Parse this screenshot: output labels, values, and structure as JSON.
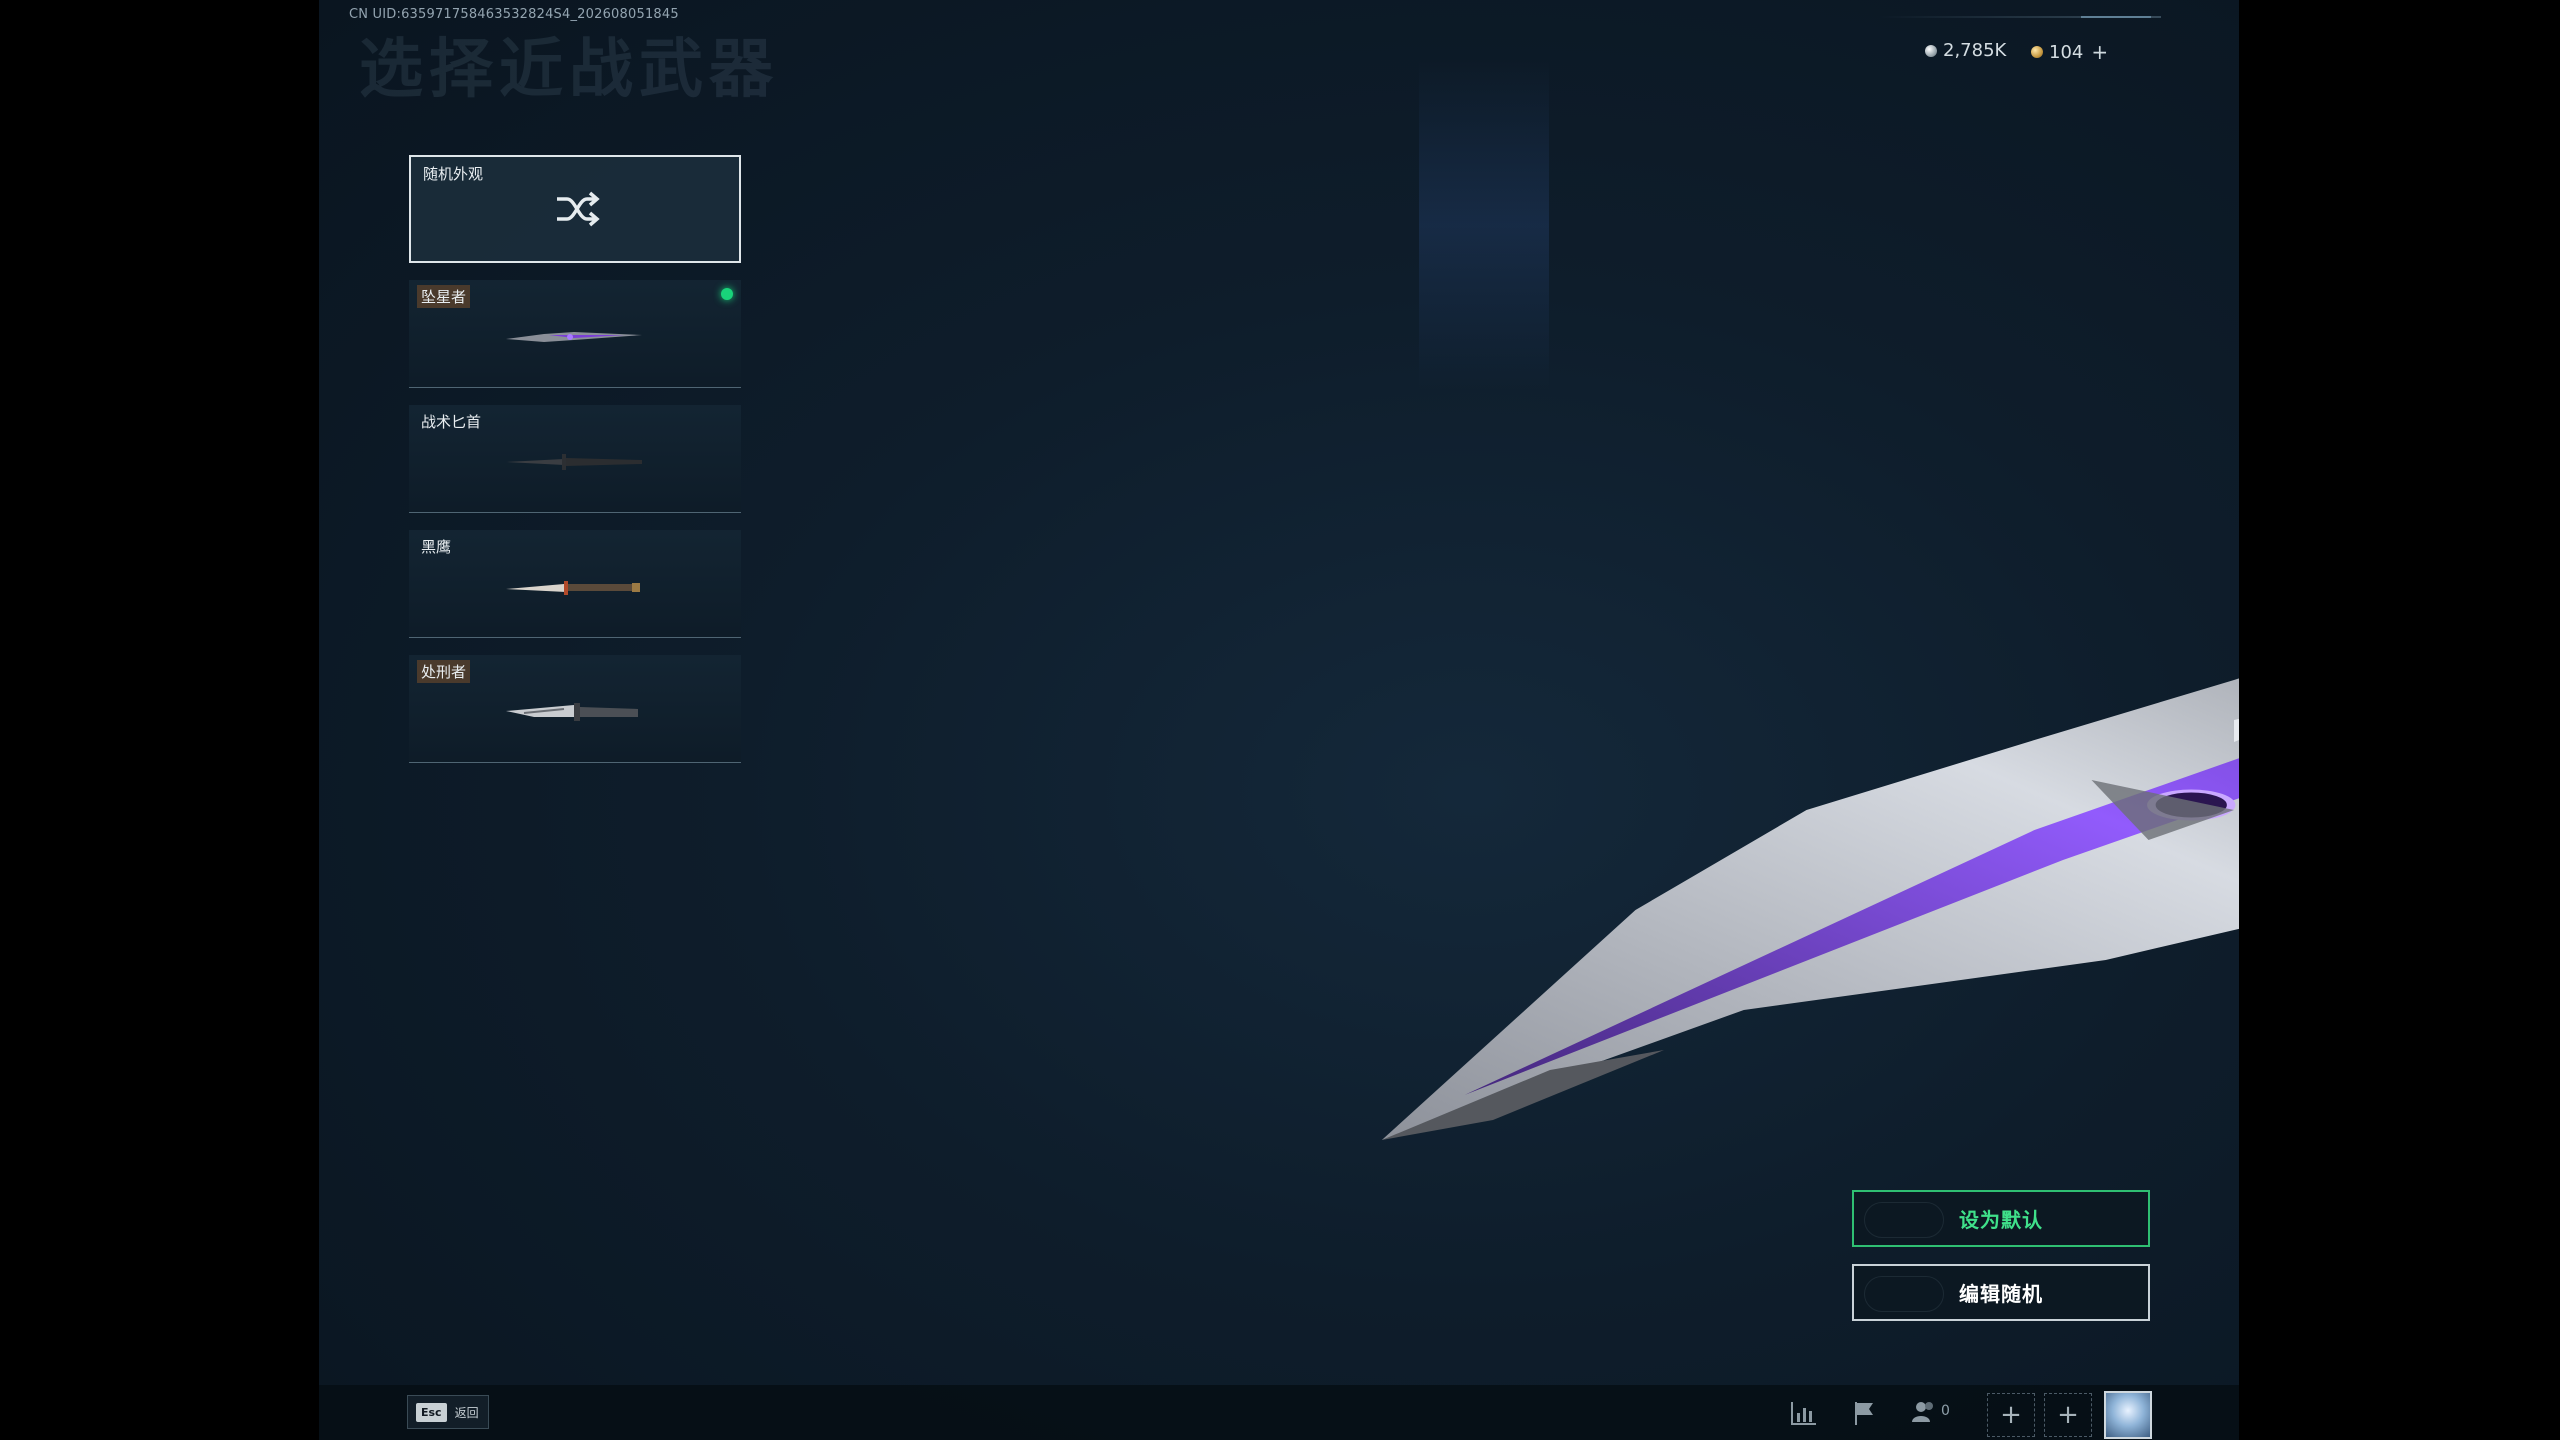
{
  "header": {
    "uid": "CN UID:635971758463532824S4_202608051845",
    "title": "选择近战武器"
  },
  "currency": {
    "silver_amount": "2,785K",
    "gold_amount": "104",
    "add_symbol": "+"
  },
  "skins": [
    {
      "label": "随机外观",
      "icon": "shuffle-icon",
      "selected": true
    },
    {
      "label": "坠星者",
      "icon": "knife-thumbnail",
      "equipped": true
    },
    {
      "label": "战术匕首",
      "icon": "knife-thumbnail"
    },
    {
      "label": "黑鹰",
      "icon": "knife-thumbnail"
    },
    {
      "label": "处刑者",
      "icon": "knife-thumbnail"
    }
  ],
  "actions": {
    "set_default": "设为默认",
    "edit_random": "编辑随机"
  },
  "bottom_bar": {
    "esc_key": "Esc",
    "back_label": "返回",
    "friends_count": "0",
    "slot_symbol": "+"
  },
  "colors": {
    "accent_green": "#19d37a",
    "blade_purple": "#7a3fd6",
    "background": "#0e1d2b"
  }
}
